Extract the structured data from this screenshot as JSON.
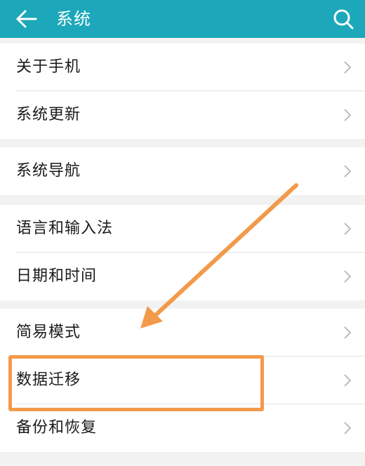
{
  "header": {
    "title": "系统",
    "back_icon": "back-arrow-icon",
    "search_icon": "search-icon",
    "background_color": "#1ca8ba"
  },
  "groups": [
    {
      "items": [
        {
          "label": "关于手机"
        },
        {
          "label": "系统更新"
        }
      ]
    },
    {
      "items": [
        {
          "label": "系统导航"
        }
      ]
    },
    {
      "items": [
        {
          "label": "语言和输入法"
        },
        {
          "label": "日期和时间"
        }
      ]
    },
    {
      "items": [
        {
          "label": "简易模式"
        },
        {
          "label": "数据迁移"
        },
        {
          "label": "备份和恢复"
        }
      ]
    }
  ],
  "annotation": {
    "highlighted_item": "数据迁移",
    "color": "#f29a4a"
  }
}
